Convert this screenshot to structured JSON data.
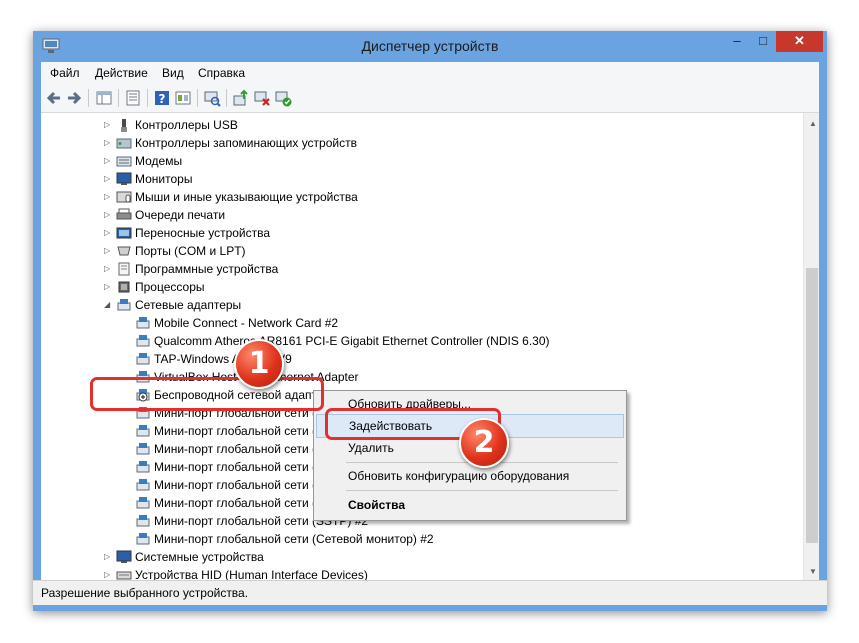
{
  "window": {
    "title": "Диспетчер устройств",
    "minimize": "–",
    "maximize": "□",
    "close": "✕"
  },
  "menu": [
    "Файл",
    "Действие",
    "Вид",
    "Справка"
  ],
  "toolbar_icons": [
    "back-icon",
    "forward-icon",
    "properties-grid-icon",
    "console-tree-icon",
    "help-icon",
    "view-icon",
    "scan-hardware-icon",
    "update-driver-icon",
    "uninstall-device-icon",
    "enable-device-icon"
  ],
  "tree": {
    "categories_top": [
      {
        "label": "Контроллеры USB",
        "icon": "usb-icon"
      },
      {
        "label": "Контроллеры запоминающих устройств",
        "icon": "storage-icon"
      },
      {
        "label": "Модемы",
        "icon": "modem-icon"
      },
      {
        "label": "Мониторы",
        "icon": "monitor-icon"
      },
      {
        "label": "Мыши и иные указывающие устройства",
        "icon": "mouse-icon"
      },
      {
        "label": "Очереди печати",
        "icon": "printer-icon"
      },
      {
        "label": "Переносные устройства",
        "icon": "portable-device-icon"
      },
      {
        "label": "Порты (COM и LPT)",
        "icon": "port-icon"
      },
      {
        "label": "Программные устройства",
        "icon": "software-device-icon"
      },
      {
        "label": "Процессоры",
        "icon": "processor-icon"
      },
      {
        "label": "Сетевые адаптеры",
        "icon": "network-adapter-icon",
        "expanded": true
      }
    ],
    "network_devices": [
      "Mobile Connect - Network Card #2",
      "Qualcomm Atheros AR8161 PCI-E Gigabit Ethernet Controller (NDIS 6.30)",
      "TAP-Windows Adapter V9",
      "VirtualBox Host-Only Ethernet Adapter",
      "Беспроводной сетевой адаптер Qualcomm Atheros",
      "Мини-порт глобальной сети (IKEv2)",
      "Мини-порт глобальной сети (IP)",
      "Мини-порт глобальной сети (IPv6)",
      "Мини-порт глобальной сети (L2TP)",
      "Мини-порт глобальной сети (PPPOE)",
      "Мини-порт глобальной сети (PPTP)",
      "Мини-порт глобальной сети (SSTP) #2",
      "Мини-порт глобальной сети (Сетевой монитор) #2"
    ],
    "categories_bottom": [
      {
        "label": "Системные устройства",
        "icon": "system-device-icon"
      },
      {
        "label": "Устройства HID (Human Interface Devices)",
        "icon": "hid-icon"
      }
    ]
  },
  "context_menu": {
    "update_drivers": "Обновить драйверы...",
    "enable": "Задействовать",
    "uninstall": "Удалить",
    "scan": "Обновить конфигурацию оборудования",
    "properties": "Свойства"
  },
  "annotations": {
    "step1": "1",
    "step2": "2"
  },
  "status": "Разрешение выбранного устройства.",
  "colors": {
    "window_border": "#6aa3e0",
    "close_button": "#c7372b",
    "callout": "#e03030",
    "highlight": "#dde9f7"
  }
}
